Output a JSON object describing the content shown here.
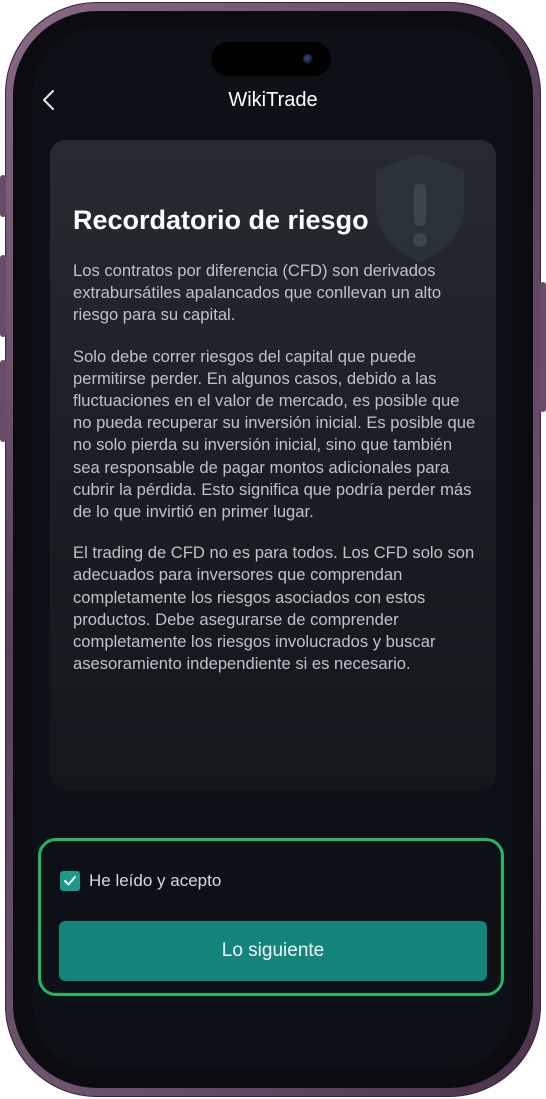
{
  "app": {
    "title": "WikiTrade"
  },
  "card": {
    "title": "Recordatorio de riesgo",
    "paragraphs": [
      "Los contratos por diferencia (CFD) son derivados extrabursátiles apalancados que conllevan un alto riesgo para su capital.",
      "Solo debe correr riesgos del capital que puede permitirse perder. En algunos casos, debido a las fluctuaciones en el valor de mercado, es posible que no pueda recuperar su inversión inicial. Es posible que no solo pierda su inversión inicial, sino que también sea responsable de pagar montos adicionales para cubrir la pérdida. Esto significa que podría perder más de lo que invirtió en primer lugar.",
      "El trading de CFD no es para todos. Los CFD solo son adecuados para inversores que comprendan completamente los riesgos asociados con estos productos. Debe asegurarse de comprender completamente los riesgos involucrados y buscar asesoramiento independiente si es necesario."
    ]
  },
  "agreement": {
    "checked": true,
    "label": "He leído y acepto"
  },
  "next_button": {
    "label": "Lo siguiente"
  },
  "colors": {
    "accent": "#14857a",
    "checkbox": "#1a9b8a",
    "highlight": "#1fb86a",
    "background": "#0d1117"
  },
  "icons": [
    "chevron-left-icon",
    "shield-warning-icon",
    "check-icon"
  ]
}
